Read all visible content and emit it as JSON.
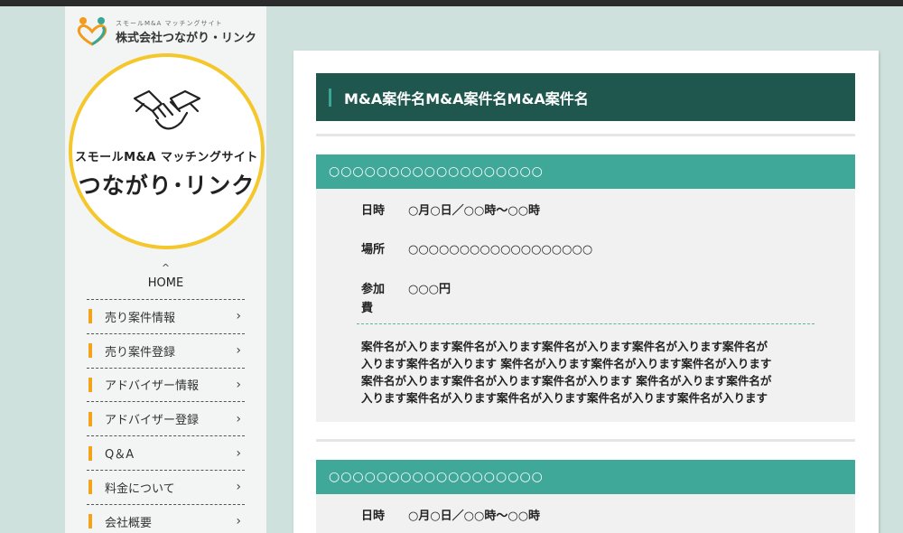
{
  "brand": {
    "sub": "スモールM&A マッチングサイト",
    "name": "株式会社つながり・リンク"
  },
  "logo": {
    "small": "スモールM&A マッチングサイト",
    "big": "つながり･リンク"
  },
  "home": {
    "caret": "^",
    "label": "HOME"
  },
  "nav": [
    {
      "label": "売り案件情報"
    },
    {
      "label": "売り案件登録"
    },
    {
      "label": "アドバイザー情報"
    },
    {
      "label": "アドバイザー登録"
    },
    {
      "label": "Q＆A"
    },
    {
      "label": "料金について"
    },
    {
      "label": "会社概要"
    }
  ],
  "main": {
    "title": "M&A案件名M&A案件名M&A案件名",
    "events": [
      {
        "heading": "○○○○○○○○○○○○○○○○○○",
        "date_key": "日時",
        "date_val": "○月○日／○○時〜○○時",
        "place_key": "場所",
        "place_val": "○○○○○○○○○○○○○○○○○○",
        "fee_key_1": "参加",
        "fee_key_2": "費",
        "fee_val": "○○○円",
        "desc_lines": [
          "案件名が入ります案件名が入ります案件名が入ります案件名が入ります案件名が",
          "入ります案件名が入ります 案件名が入ります案件名が入ります案件名が入ります",
          "案件名が入ります案件名が入ります案件名が入ります 案件名が入ります案件名が",
          "入ります案件名が入ります案件名が入ります案件名が入ります案件名が入ります"
        ]
      },
      {
        "heading": "○○○○○○○○○○○○○○○○○○",
        "date_key": "日時",
        "date_val": "○月○日／○○時〜○○時"
      }
    ]
  },
  "colors": {
    "background": "#cfe1dc",
    "title_bar": "#1f574f",
    "event_header": "#40a898",
    "nav_accent": "#f2a51c",
    "logo_ring": "#f4c72c"
  },
  "icons": [
    "tsunagari-logo-icon",
    "handshake-icon",
    "chevron-up-icon",
    "chevron-right-icon"
  ]
}
